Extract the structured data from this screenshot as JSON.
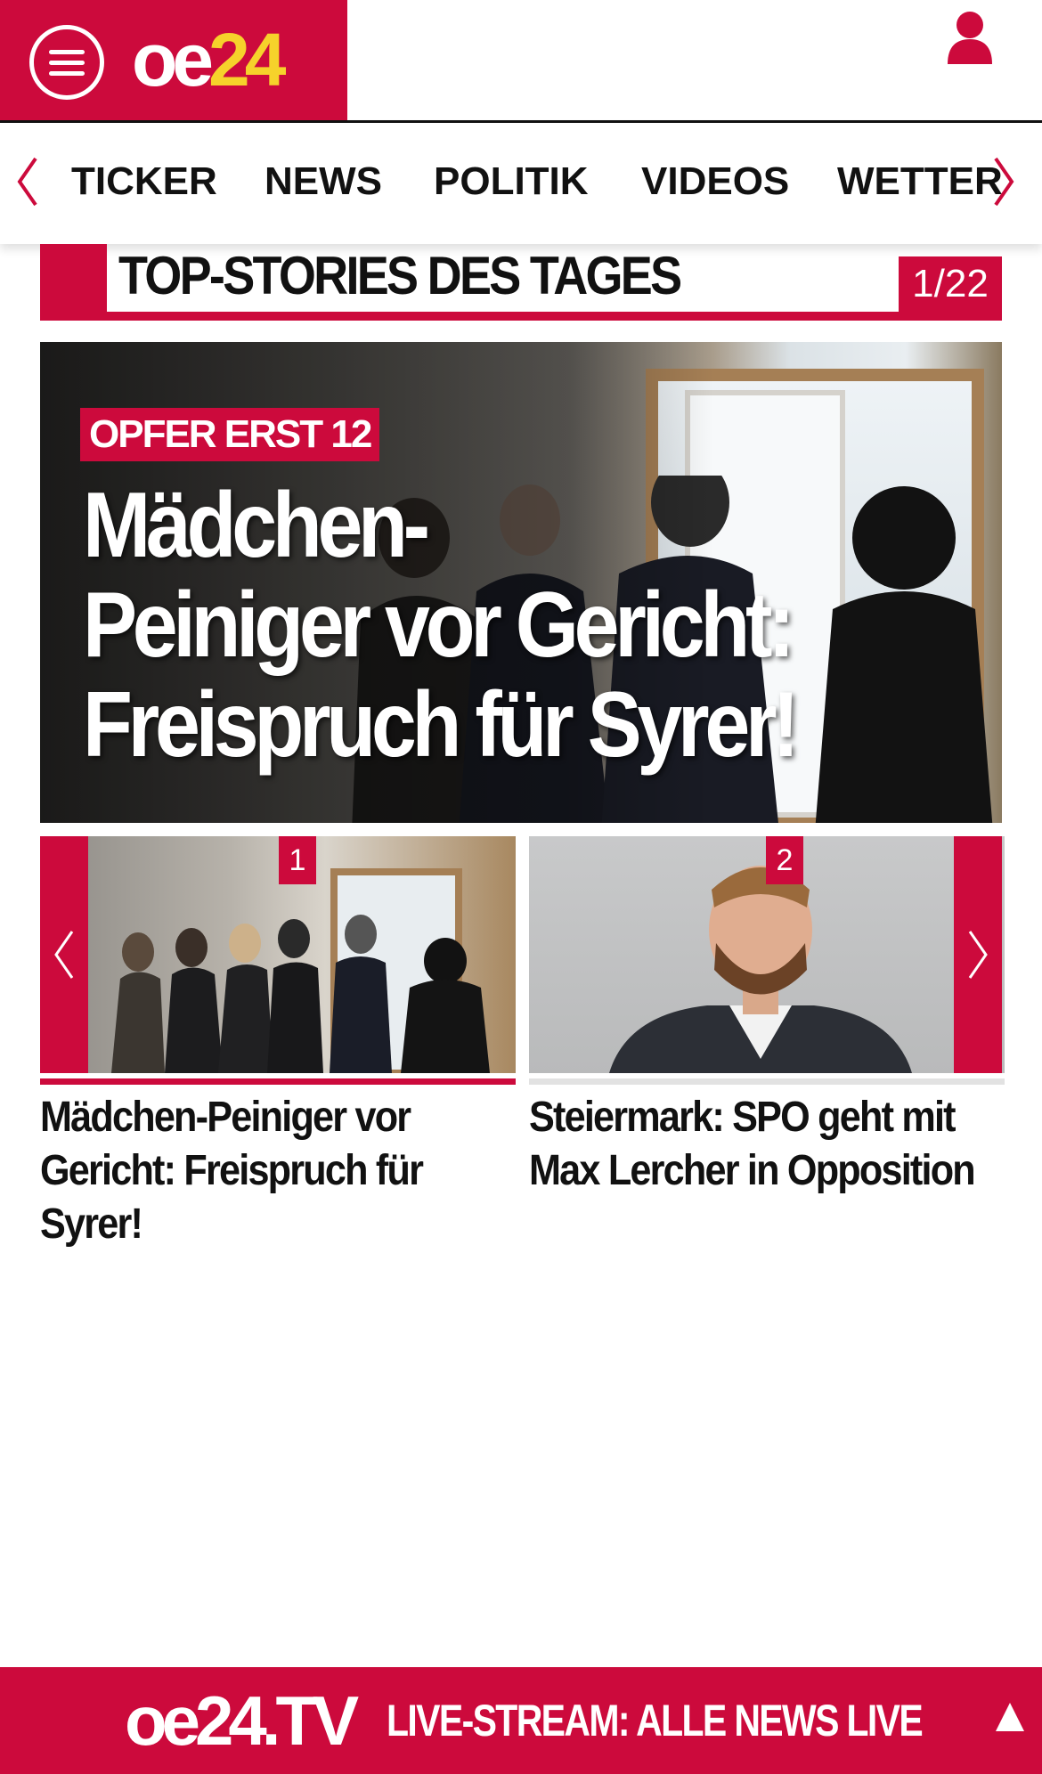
{
  "colors": {
    "brand_red": "#cc0a3c",
    "logo_yellow": "#f6d22b",
    "text": "#111111"
  },
  "header": {
    "logo_oe": "oe",
    "logo_num": "24",
    "menu_icon": "hamburger-menu-icon",
    "user_icon": "user-icon"
  },
  "nav": {
    "items": [
      "TICKER",
      "NEWS",
      "POLITIK",
      "VIDEOS",
      "WETTER"
    ]
  },
  "section": {
    "title": "TOP-STORIES DES TAGES",
    "counter": "1/22"
  },
  "hero": {
    "kicker": "OPFER ERST 12",
    "title_lines": [
      "Mädchen-",
      "Peiniger vor Gericht:",
      "Freispruch für Syrer!"
    ]
  },
  "teasers": [
    {
      "number": "1",
      "title_lines": [
        "Mädchen-Peiniger vor",
        "Gericht: Freispruch für",
        "Syrer!"
      ]
    },
    {
      "number": "2",
      "title_lines": [
        "Steiermark: SPO geht mit",
        "Max Lercher in Opposition"
      ]
    }
  ],
  "livebar": {
    "logo": "oe24.TV",
    "text": "LIVE-STREAM:  ALLE NEWS LIVE"
  }
}
